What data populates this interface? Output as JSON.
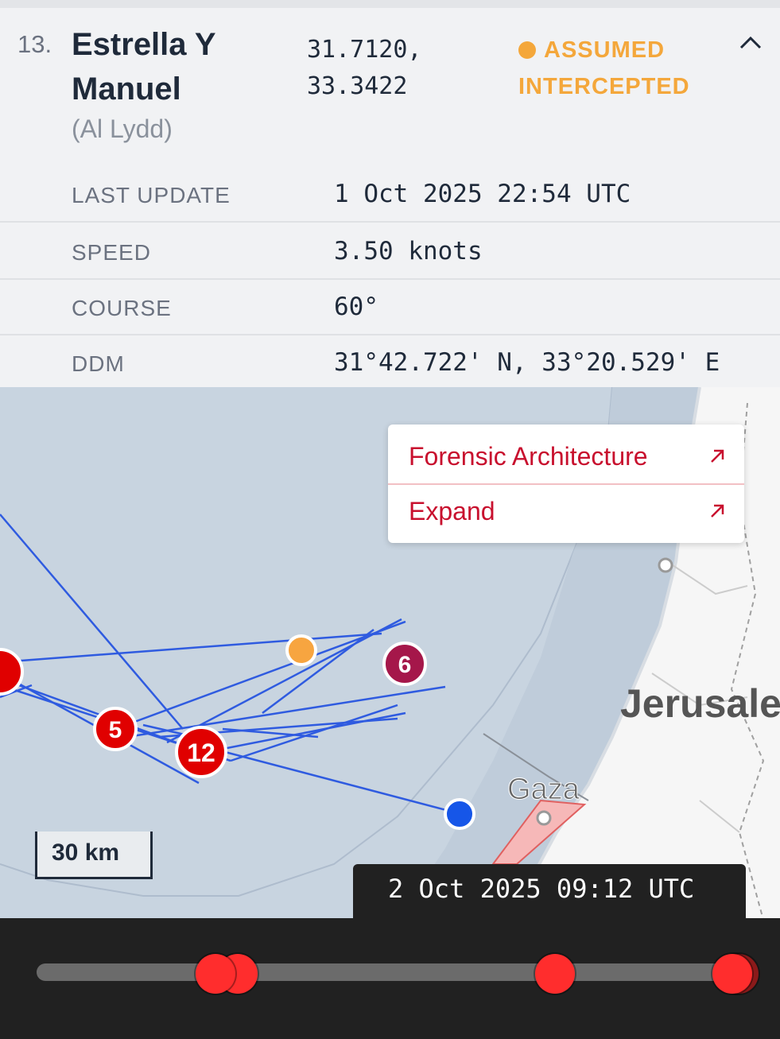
{
  "vessel": {
    "number": "13.",
    "name": "Estrella Y Manuel",
    "subname": "(Al Lydd)",
    "coords_line1": "31.7120,",
    "coords_line2": "33.3422",
    "status": "ASSUMED INTERCEPTED",
    "status_color": "#f4a73b"
  },
  "details": [
    {
      "label": "LAST UPDATE",
      "value": "1 Oct 2025 22:54 UTC"
    },
    {
      "label": "SPEED",
      "value": "3.50 knots"
    },
    {
      "label": "COURSE",
      "value": "60°"
    },
    {
      "label": "DDM",
      "value": "31°42.722' N, 33°20.529' E"
    }
  ],
  "popup": {
    "items": [
      {
        "label": "Forensic Architecture",
        "icon": "external-arrow-icon"
      },
      {
        "label": "Expand",
        "icon": "external-arrow-icon"
      }
    ]
  },
  "map": {
    "labels": {
      "city1": "Jerusalem",
      "city2": "Gaza"
    },
    "markers": [
      {
        "label": "5",
        "color": "#e00000"
      },
      {
        "label": "12",
        "color": "#e00000"
      },
      {
        "label": "6",
        "color": "#a5174a"
      }
    ],
    "scale": "30 km",
    "track_color": "#2f5be0"
  },
  "timeline": {
    "current_time": "2 Oct 2025 09:12 UTC",
    "handle_color": "#ff2d2d"
  }
}
